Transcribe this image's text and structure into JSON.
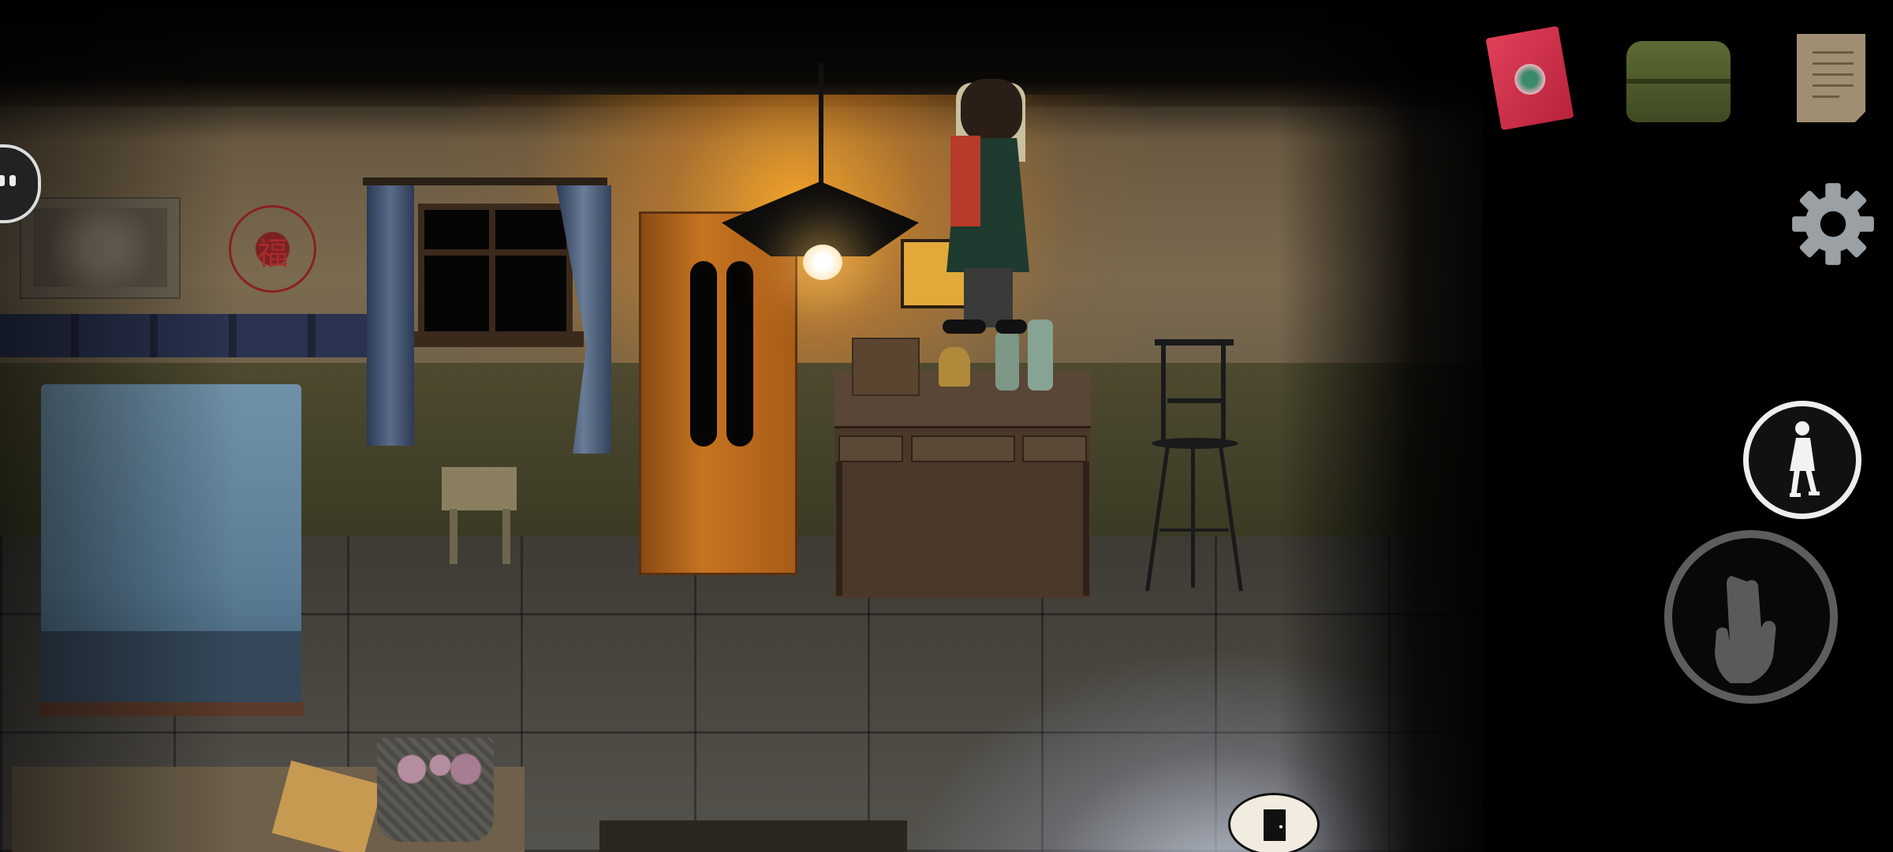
{
  "scene": {
    "room_label": "",
    "wall_character": "福"
  },
  "hud": {
    "pause_icon": "pause-icon",
    "inventory": [
      {
        "id": "red-book",
        "icon": "red-book-icon"
      },
      {
        "id": "green-bag",
        "icon": "green-bag-icon"
      },
      {
        "id": "paper-note",
        "icon": "paper-note-icon"
      }
    ],
    "settings_icon": "gear-icon",
    "walk_icon": "walking-person-icon",
    "interact_icon": "pointing-hand-icon",
    "exit_icon": "door-icon"
  },
  "colors": {
    "lamp_glow": "#ffaa28",
    "ui_white": "#eeeeee",
    "ui_dark": "#111111"
  }
}
